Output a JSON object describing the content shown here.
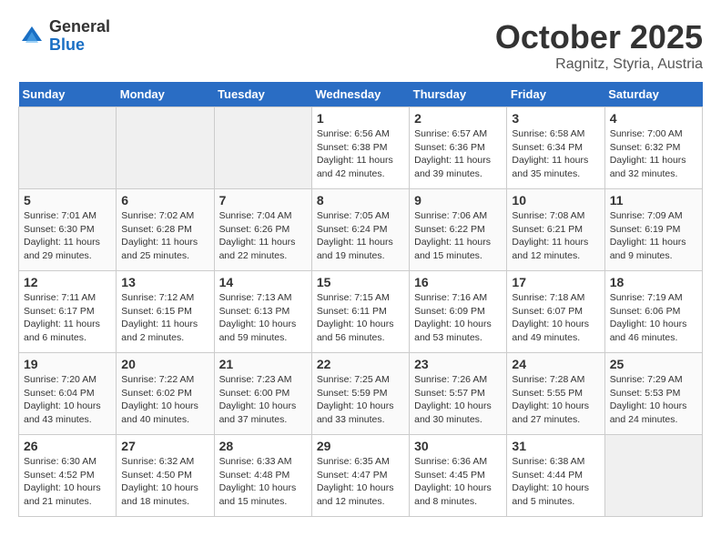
{
  "header": {
    "logo_general": "General",
    "logo_blue": "Blue",
    "month_title": "October 2025",
    "location": "Ragnitz, Styria, Austria"
  },
  "weekdays": [
    "Sunday",
    "Monday",
    "Tuesday",
    "Wednesday",
    "Thursday",
    "Friday",
    "Saturday"
  ],
  "weeks": [
    [
      {
        "day": "",
        "info": ""
      },
      {
        "day": "",
        "info": ""
      },
      {
        "day": "",
        "info": ""
      },
      {
        "day": "1",
        "info": "Sunrise: 6:56 AM\nSunset: 6:38 PM\nDaylight: 11 hours\nand 42 minutes."
      },
      {
        "day": "2",
        "info": "Sunrise: 6:57 AM\nSunset: 6:36 PM\nDaylight: 11 hours\nand 39 minutes."
      },
      {
        "day": "3",
        "info": "Sunrise: 6:58 AM\nSunset: 6:34 PM\nDaylight: 11 hours\nand 35 minutes."
      },
      {
        "day": "4",
        "info": "Sunrise: 7:00 AM\nSunset: 6:32 PM\nDaylight: 11 hours\nand 32 minutes."
      }
    ],
    [
      {
        "day": "5",
        "info": "Sunrise: 7:01 AM\nSunset: 6:30 PM\nDaylight: 11 hours\nand 29 minutes."
      },
      {
        "day": "6",
        "info": "Sunrise: 7:02 AM\nSunset: 6:28 PM\nDaylight: 11 hours\nand 25 minutes."
      },
      {
        "day": "7",
        "info": "Sunrise: 7:04 AM\nSunset: 6:26 PM\nDaylight: 11 hours\nand 22 minutes."
      },
      {
        "day": "8",
        "info": "Sunrise: 7:05 AM\nSunset: 6:24 PM\nDaylight: 11 hours\nand 19 minutes."
      },
      {
        "day": "9",
        "info": "Sunrise: 7:06 AM\nSunset: 6:22 PM\nDaylight: 11 hours\nand 15 minutes."
      },
      {
        "day": "10",
        "info": "Sunrise: 7:08 AM\nSunset: 6:21 PM\nDaylight: 11 hours\nand 12 minutes."
      },
      {
        "day": "11",
        "info": "Sunrise: 7:09 AM\nSunset: 6:19 PM\nDaylight: 11 hours\nand 9 minutes."
      }
    ],
    [
      {
        "day": "12",
        "info": "Sunrise: 7:11 AM\nSunset: 6:17 PM\nDaylight: 11 hours\nand 6 minutes."
      },
      {
        "day": "13",
        "info": "Sunrise: 7:12 AM\nSunset: 6:15 PM\nDaylight: 11 hours\nand 2 minutes."
      },
      {
        "day": "14",
        "info": "Sunrise: 7:13 AM\nSunset: 6:13 PM\nDaylight: 10 hours\nand 59 minutes."
      },
      {
        "day": "15",
        "info": "Sunrise: 7:15 AM\nSunset: 6:11 PM\nDaylight: 10 hours\nand 56 minutes."
      },
      {
        "day": "16",
        "info": "Sunrise: 7:16 AM\nSunset: 6:09 PM\nDaylight: 10 hours\nand 53 minutes."
      },
      {
        "day": "17",
        "info": "Sunrise: 7:18 AM\nSunset: 6:07 PM\nDaylight: 10 hours\nand 49 minutes."
      },
      {
        "day": "18",
        "info": "Sunrise: 7:19 AM\nSunset: 6:06 PM\nDaylight: 10 hours\nand 46 minutes."
      }
    ],
    [
      {
        "day": "19",
        "info": "Sunrise: 7:20 AM\nSunset: 6:04 PM\nDaylight: 10 hours\nand 43 minutes."
      },
      {
        "day": "20",
        "info": "Sunrise: 7:22 AM\nSunset: 6:02 PM\nDaylight: 10 hours\nand 40 minutes."
      },
      {
        "day": "21",
        "info": "Sunrise: 7:23 AM\nSunset: 6:00 PM\nDaylight: 10 hours\nand 37 minutes."
      },
      {
        "day": "22",
        "info": "Sunrise: 7:25 AM\nSunset: 5:59 PM\nDaylight: 10 hours\nand 33 minutes."
      },
      {
        "day": "23",
        "info": "Sunrise: 7:26 AM\nSunset: 5:57 PM\nDaylight: 10 hours\nand 30 minutes."
      },
      {
        "day": "24",
        "info": "Sunrise: 7:28 AM\nSunset: 5:55 PM\nDaylight: 10 hours\nand 27 minutes."
      },
      {
        "day": "25",
        "info": "Sunrise: 7:29 AM\nSunset: 5:53 PM\nDaylight: 10 hours\nand 24 minutes."
      }
    ],
    [
      {
        "day": "26",
        "info": "Sunrise: 6:30 AM\nSunset: 4:52 PM\nDaylight: 10 hours\nand 21 minutes."
      },
      {
        "day": "27",
        "info": "Sunrise: 6:32 AM\nSunset: 4:50 PM\nDaylight: 10 hours\nand 18 minutes."
      },
      {
        "day": "28",
        "info": "Sunrise: 6:33 AM\nSunset: 4:48 PM\nDaylight: 10 hours\nand 15 minutes."
      },
      {
        "day": "29",
        "info": "Sunrise: 6:35 AM\nSunset: 4:47 PM\nDaylight: 10 hours\nand 12 minutes."
      },
      {
        "day": "30",
        "info": "Sunrise: 6:36 AM\nSunset: 4:45 PM\nDaylight: 10 hours\nand 8 minutes."
      },
      {
        "day": "31",
        "info": "Sunrise: 6:38 AM\nSunset: 4:44 PM\nDaylight: 10 hours\nand 5 minutes."
      },
      {
        "day": "",
        "info": ""
      }
    ]
  ]
}
